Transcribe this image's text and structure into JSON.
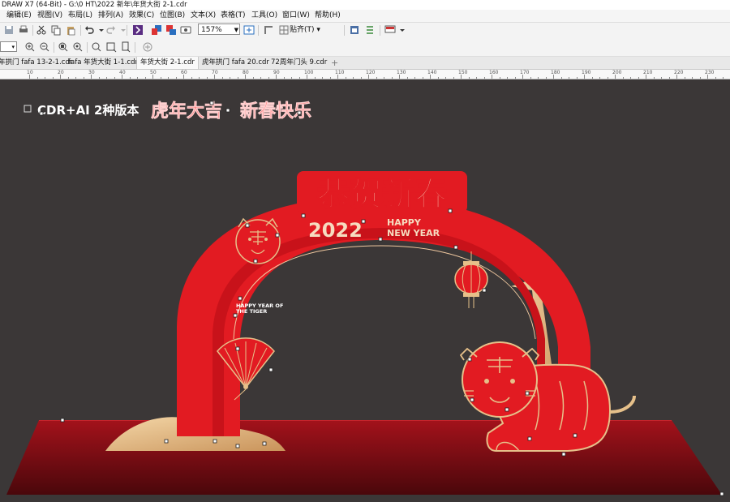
{
  "window": {
    "title": "DRAW X7 (64-Bit) - G:\\0 HT\\2022 新年\\年货大街 2-1.cdr"
  },
  "menu": [
    "编辑(E)",
    "视图(V)",
    "布局(L)",
    "排列(A)",
    "效果(C)",
    "位图(B)",
    "文本(X)",
    "表格(T)",
    "工具(O)",
    "窗口(W)",
    "帮助(H)"
  ],
  "toolbar": {
    "zoom_value": "157%",
    "snap_label": "贴齐(T)"
  },
  "tabs": [
    "年拱门 fafa 13-2-1.cdr",
    "fafa 年货大街 1-1.cdr",
    "年货大街 2-1.cdr",
    "虎年拱门 fafa 20.cdr",
    "72周年门头 9.cdr"
  ],
  "active_tab": 2,
  "ruler": [
    "10",
    "20",
    "30",
    "40",
    "50",
    "60",
    "70",
    "80",
    "90",
    "100",
    "110",
    "120",
    "130",
    "140",
    "150",
    "160",
    "170",
    "180",
    "190",
    "200",
    "210",
    "220",
    "230"
  ],
  "artwork": {
    "version_label": "CDR+AI 2种版本",
    "slogan_left": "虎年大吉",
    "slogan_right": "新春快乐",
    "main_title": "恭贺新春",
    "year": "2022",
    "happy": "HAPPY",
    "new_year": "NEW YEAR",
    "tiger_tag_line1": "HAPPY YEAR OF",
    "tiger_tag_line2": "THE TIGER"
  },
  "colors": {
    "red": "#e21b22",
    "gold": "#e6c08a",
    "canvas": "#3b3737",
    "stage": "#8b0f16"
  }
}
